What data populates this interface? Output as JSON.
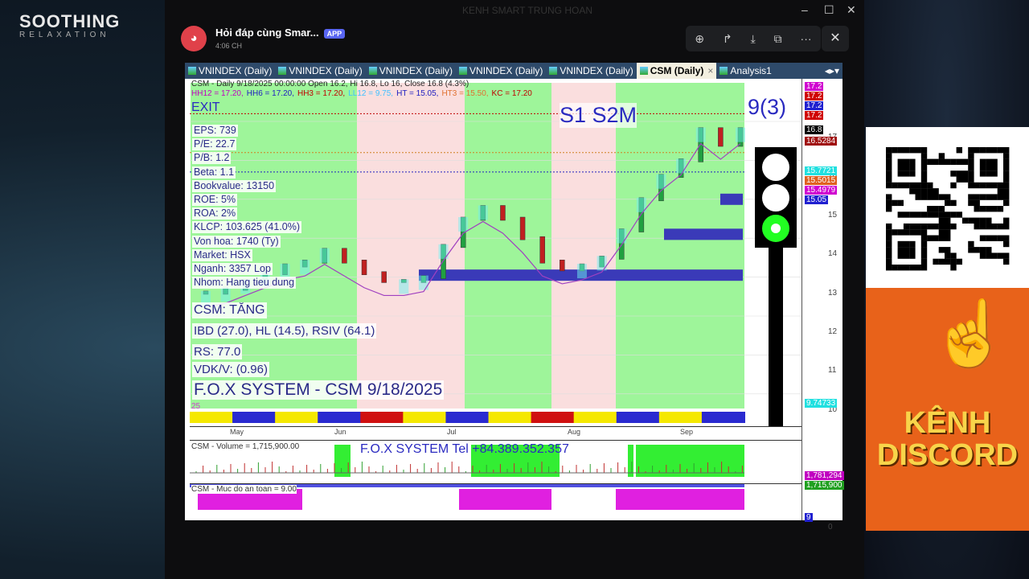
{
  "background": {
    "logo": {
      "line1": "SOOTHING",
      "line2": "RELAXATION"
    }
  },
  "window": {
    "title": "KENH SMART TRUNG HOAN",
    "controls": [
      "–",
      "☐",
      "✕"
    ]
  },
  "discord": {
    "channel": "Hỏi đáp cùng Smar...",
    "badge": "APP",
    "time": "4:06 CH",
    "toolbar": [
      "zoom-in",
      "forward",
      "download",
      "open-external",
      "more"
    ],
    "close": "✕"
  },
  "tabs": [
    {
      "label": "VNINDEX (Daily)"
    },
    {
      "label": "VNINDEX (Daily)"
    },
    {
      "label": "VNINDEX (Daily)"
    },
    {
      "label": "VNINDEX (Daily)"
    },
    {
      "label": "VNINDEX (Daily)"
    },
    {
      "label": "CSM (Daily)",
      "active": true,
      "close": "×"
    },
    {
      "label": "Analysis1"
    }
  ],
  "chart": {
    "header": "CSM - Daily 9/18/2025 00:00:00 Open 16.2, Hi 16.8, Lo 16, Close 16.8 (4.3%)",
    "levels": [
      {
        "text": "HH12 = 17.20,",
        "color": "#c000c0"
      },
      {
        "text": "HH6 = 17.20,",
        "color": "#2020c0"
      },
      {
        "text": "HH3 = 17.20,",
        "color": "#c00000"
      },
      {
        "text": "LL12 = 9.75,",
        "color": "#40c0ff"
      },
      {
        "text": "HT = 15.05,",
        "color": "#2020c0"
      },
      {
        "text": "HT3 = 15.50,",
        "color": "#e07030"
      },
      {
        "text": "KC = 17.20",
        "color": "#c00000"
      }
    ],
    "exit": "EXIT",
    "signals": "S1  S2M",
    "count": "9(3)",
    "fundamentals": [
      "EPS: 739",
      "P/E: 22.7",
      "P/B: 1.2",
      "Beta: 1.1",
      "Bookvalue: 13150",
      "ROE: 5%",
      "ROA: 2%",
      "KLCP: 103.625 (41.0%)",
      "Von hoa: 1740 (Ty)",
      "Market: HSX",
      "Nganh: 3357 Lop",
      "Nhom: Hang tieu dung"
    ],
    "trend": "CSM: TĂNG",
    "indicators": "IBD (27.0), HL (14.5), RSIV (64.1)",
    "rs": "RS: 77.0",
    "vdk": "VDK/V:  (0.96)",
    "system": "F.O.X SYSTEM - CSM 9/18/2025",
    "small_label": "25",
    "months": [
      "May",
      "Jun",
      "Jul",
      "Aug",
      "Sep"
    ],
    "price_ticks": [
      "17",
      "16",
      "15",
      "14",
      "13",
      "12",
      "11",
      "10"
    ],
    "price_labels": [
      {
        "text": "17.2",
        "color": "#d000d0"
      },
      {
        "text": "17.2",
        "color": "#d00000"
      },
      {
        "text": "17.2",
        "color": "#2020d0"
      },
      {
        "text": "17.2",
        "color": "#d00000"
      },
      {
        "text": "16.8",
        "color": "#000000"
      },
      {
        "text": "16.5284",
        "color": "#a01010"
      },
      {
        "text": "15.7721",
        "color": "#20e0e0"
      },
      {
        "text": "15.5015",
        "color": "#e06020"
      },
      {
        "text": "15.4979",
        "color": "#d000d0"
      },
      {
        "text": "15.05",
        "color": "#2020d0"
      },
      {
        "text": "9.74733",
        "color": "#20e0e0"
      }
    ],
    "price_trend": [
      12.6,
      12.7,
      12.9,
      13.1,
      13.3,
      13.4,
      13.7,
      13.4,
      13.1,
      12.9,
      12.9,
      13.0,
      13.8,
      14.5,
      14.8,
      14.5,
      14.0,
      13.4,
      13.2,
      13.3,
      13.5,
      14.2,
      15.0,
      15.6,
      16.0,
      16.8,
      16.4,
      16.8
    ],
    "traffic_light": {
      "active": "green"
    },
    "colors": {
      "bull_zone": "#9ef59a",
      "bear_zone": "#fadede",
      "accent": "#2a2a88"
    }
  },
  "volume": {
    "title": "CSM - Volume = 1,715,900.00",
    "banner": "F.O.X SYSTEM Tel +84.389.352.357",
    "labels": [
      {
        "text": "1,781,294",
        "color": "#c000c0"
      },
      {
        "text": "1,715,900",
        "color": "#20a020"
      }
    ]
  },
  "safety": {
    "title": "CSM - Muc do an toan = 9.00",
    "label": "9",
    "tick": "0"
  },
  "ad": {
    "line1": "KÊNH",
    "line2": "DISCORD"
  }
}
